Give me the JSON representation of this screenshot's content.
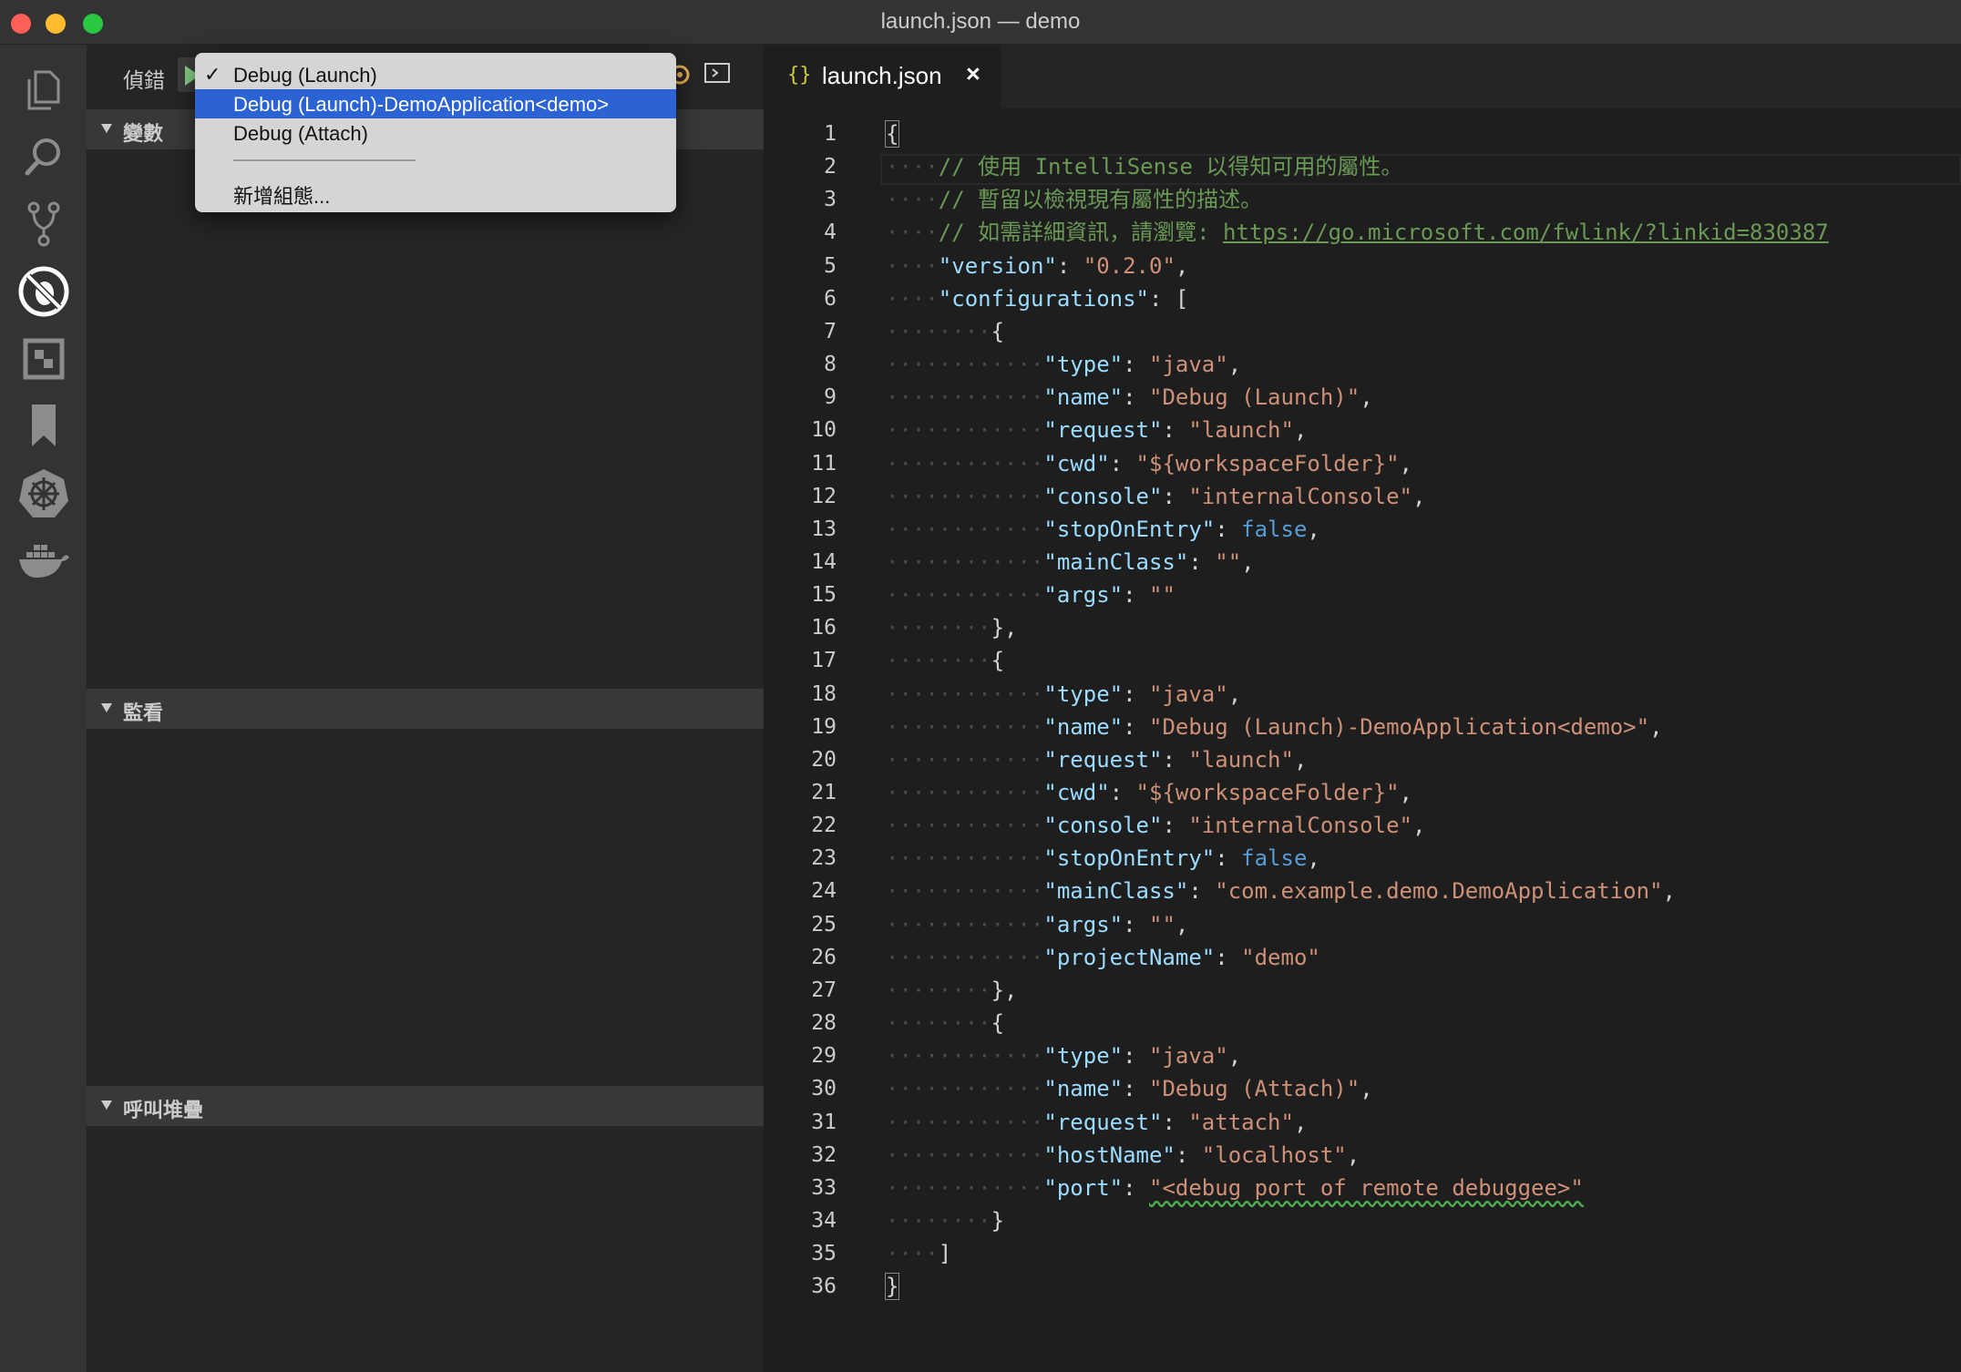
{
  "window": {
    "title": "launch.json — demo"
  },
  "activity_bar": {
    "items": [
      "explorer-icon",
      "search-icon",
      "source-control-icon",
      "debug-icon",
      "extensions-icon",
      "bookmark-icon",
      "kubernetes-icon",
      "docker-icon"
    ]
  },
  "sidebar": {
    "debug_title": "偵錯",
    "sections": {
      "variables": "變數",
      "watch": "監看",
      "call_stack": "呼叫堆疊"
    }
  },
  "dropdown": {
    "items": [
      "Debug (Launch)",
      "Debug (Launch)-DemoApplication<demo>",
      "Debug (Attach)"
    ],
    "selected_index": 1,
    "checked_index": 0,
    "check_mark": "✓",
    "add_config": "新增組態..."
  },
  "editor": {
    "tab": {
      "icon": "{}",
      "label": "launch.json",
      "close": "×"
    },
    "line_numbers": [
      "1",
      "2",
      "3",
      "4",
      "5",
      "6",
      "7",
      "8",
      "9",
      "10",
      "11",
      "12",
      "13",
      "14",
      "15",
      "16",
      "17",
      "18",
      "19",
      "20",
      "21",
      "22",
      "23",
      "24",
      "25",
      "26",
      "27",
      "28",
      "29",
      "30",
      "31",
      "32",
      "33",
      "34",
      "35",
      "36"
    ],
    "lines": [
      [
        {
          "t": "{",
          "c": "p brk"
        }
      ],
      [
        {
          "t": "····",
          "c": "ws"
        },
        {
          "t": "// 使用 IntelliSense 以得知可用的屬性。",
          "c": "c"
        }
      ],
      [
        {
          "t": "····",
          "c": "ws"
        },
        {
          "t": "// 暫留以檢視現有屬性的描述。",
          "c": "c"
        }
      ],
      [
        {
          "t": "····",
          "c": "ws"
        },
        {
          "t": "// 如需詳細資訊，請瀏覽: ",
          "c": "c"
        },
        {
          "t": "https://go.microsoft.com/fwlink/?linkid=830387",
          "c": "c lnk"
        }
      ],
      [
        {
          "t": "····",
          "c": "ws"
        },
        {
          "t": "\"version\"",
          "c": "k"
        },
        {
          "t": ": ",
          "c": "p"
        },
        {
          "t": "\"0.2.0\"",
          "c": "s"
        },
        {
          "t": ",",
          "c": "p"
        }
      ],
      [
        {
          "t": "····",
          "c": "ws"
        },
        {
          "t": "\"configurations\"",
          "c": "k"
        },
        {
          "t": ": [",
          "c": "p"
        }
      ],
      [
        {
          "t": "········",
          "c": "ws"
        },
        {
          "t": "{",
          "c": "p"
        }
      ],
      [
        {
          "t": "············",
          "c": "ws"
        },
        {
          "t": "\"type\"",
          "c": "k"
        },
        {
          "t": ": ",
          "c": "p"
        },
        {
          "t": "\"java\"",
          "c": "s"
        },
        {
          "t": ",",
          "c": "p"
        }
      ],
      [
        {
          "t": "············",
          "c": "ws"
        },
        {
          "t": "\"name\"",
          "c": "k"
        },
        {
          "t": ": ",
          "c": "p"
        },
        {
          "t": "\"Debug (Launch)\"",
          "c": "s"
        },
        {
          "t": ",",
          "c": "p"
        }
      ],
      [
        {
          "t": "············",
          "c": "ws"
        },
        {
          "t": "\"request\"",
          "c": "k"
        },
        {
          "t": ": ",
          "c": "p"
        },
        {
          "t": "\"launch\"",
          "c": "s"
        },
        {
          "t": ",",
          "c": "p"
        }
      ],
      [
        {
          "t": "············",
          "c": "ws"
        },
        {
          "t": "\"cwd\"",
          "c": "k"
        },
        {
          "t": ": ",
          "c": "p"
        },
        {
          "t": "\"${workspaceFolder}\"",
          "c": "s"
        },
        {
          "t": ",",
          "c": "p"
        }
      ],
      [
        {
          "t": "············",
          "c": "ws"
        },
        {
          "t": "\"console\"",
          "c": "k"
        },
        {
          "t": ": ",
          "c": "p"
        },
        {
          "t": "\"internalConsole\"",
          "c": "s"
        },
        {
          "t": ",",
          "c": "p"
        }
      ],
      [
        {
          "t": "············",
          "c": "ws"
        },
        {
          "t": "\"stopOnEntry\"",
          "c": "k"
        },
        {
          "t": ": ",
          "c": "p"
        },
        {
          "t": "false",
          "c": "b"
        },
        {
          "t": ",",
          "c": "p"
        }
      ],
      [
        {
          "t": "············",
          "c": "ws"
        },
        {
          "t": "\"mainClass\"",
          "c": "k"
        },
        {
          "t": ": ",
          "c": "p"
        },
        {
          "t": "\"\"",
          "c": "s"
        },
        {
          "t": ",",
          "c": "p"
        }
      ],
      [
        {
          "t": "············",
          "c": "ws"
        },
        {
          "t": "\"args\"",
          "c": "k"
        },
        {
          "t": ": ",
          "c": "p"
        },
        {
          "t": "\"\"",
          "c": "s"
        }
      ],
      [
        {
          "t": "········",
          "c": "ws"
        },
        {
          "t": "},",
          "c": "p"
        }
      ],
      [
        {
          "t": "········",
          "c": "ws"
        },
        {
          "t": "{",
          "c": "p"
        }
      ],
      [
        {
          "t": "············",
          "c": "ws"
        },
        {
          "t": "\"type\"",
          "c": "k"
        },
        {
          "t": ": ",
          "c": "p"
        },
        {
          "t": "\"java\"",
          "c": "s"
        },
        {
          "t": ",",
          "c": "p"
        }
      ],
      [
        {
          "t": "············",
          "c": "ws"
        },
        {
          "t": "\"name\"",
          "c": "k"
        },
        {
          "t": ": ",
          "c": "p"
        },
        {
          "t": "\"Debug (Launch)-DemoApplication<demo>\"",
          "c": "s"
        },
        {
          "t": ",",
          "c": "p"
        }
      ],
      [
        {
          "t": "············",
          "c": "ws"
        },
        {
          "t": "\"request\"",
          "c": "k"
        },
        {
          "t": ": ",
          "c": "p"
        },
        {
          "t": "\"launch\"",
          "c": "s"
        },
        {
          "t": ",",
          "c": "p"
        }
      ],
      [
        {
          "t": "············",
          "c": "ws"
        },
        {
          "t": "\"cwd\"",
          "c": "k"
        },
        {
          "t": ": ",
          "c": "p"
        },
        {
          "t": "\"${workspaceFolder}\"",
          "c": "s"
        },
        {
          "t": ",",
          "c": "p"
        }
      ],
      [
        {
          "t": "············",
          "c": "ws"
        },
        {
          "t": "\"console\"",
          "c": "k"
        },
        {
          "t": ": ",
          "c": "p"
        },
        {
          "t": "\"internalConsole\"",
          "c": "s"
        },
        {
          "t": ",",
          "c": "p"
        }
      ],
      [
        {
          "t": "············",
          "c": "ws"
        },
        {
          "t": "\"stopOnEntry\"",
          "c": "k"
        },
        {
          "t": ": ",
          "c": "p"
        },
        {
          "t": "false",
          "c": "b"
        },
        {
          "t": ",",
          "c": "p"
        }
      ],
      [
        {
          "t": "············",
          "c": "ws"
        },
        {
          "t": "\"mainClass\"",
          "c": "k"
        },
        {
          "t": ": ",
          "c": "p"
        },
        {
          "t": "\"com.example.demo.DemoApplication\"",
          "c": "s"
        },
        {
          "t": ",",
          "c": "p"
        }
      ],
      [
        {
          "t": "············",
          "c": "ws"
        },
        {
          "t": "\"args\"",
          "c": "k"
        },
        {
          "t": ": ",
          "c": "p"
        },
        {
          "t": "\"\"",
          "c": "s"
        },
        {
          "t": ",",
          "c": "p"
        }
      ],
      [
        {
          "t": "············",
          "c": "ws"
        },
        {
          "t": "\"projectName\"",
          "c": "k"
        },
        {
          "t": ": ",
          "c": "p"
        },
        {
          "t": "\"demo\"",
          "c": "s"
        }
      ],
      [
        {
          "t": "········",
          "c": "ws"
        },
        {
          "t": "},",
          "c": "p"
        }
      ],
      [
        {
          "t": "········",
          "c": "ws"
        },
        {
          "t": "{",
          "c": "p"
        }
      ],
      [
        {
          "t": "············",
          "c": "ws"
        },
        {
          "t": "\"type\"",
          "c": "k"
        },
        {
          "t": ": ",
          "c": "p"
        },
        {
          "t": "\"java\"",
          "c": "s"
        },
        {
          "t": ",",
          "c": "p"
        }
      ],
      [
        {
          "t": "············",
          "c": "ws"
        },
        {
          "t": "\"name\"",
          "c": "k"
        },
        {
          "t": ": ",
          "c": "p"
        },
        {
          "t": "\"Debug (Attach)\"",
          "c": "s"
        },
        {
          "t": ",",
          "c": "p"
        }
      ],
      [
        {
          "t": "············",
          "c": "ws"
        },
        {
          "t": "\"request\"",
          "c": "k"
        },
        {
          "t": ": ",
          "c": "p"
        },
        {
          "t": "\"attach\"",
          "c": "s"
        },
        {
          "t": ",",
          "c": "p"
        }
      ],
      [
        {
          "t": "············",
          "c": "ws"
        },
        {
          "t": "\"hostName\"",
          "c": "k"
        },
        {
          "t": ": ",
          "c": "p"
        },
        {
          "t": "\"localhost\"",
          "c": "s"
        },
        {
          "t": ",",
          "c": "p"
        }
      ],
      [
        {
          "t": "············",
          "c": "ws"
        },
        {
          "t": "\"port\"",
          "c": "k"
        },
        {
          "t": ": ",
          "c": "p"
        },
        {
          "t": "\"<debug port of remote debuggee>\"",
          "c": "s err"
        }
      ],
      [
        {
          "t": "········",
          "c": "ws"
        },
        {
          "t": "}",
          "c": "p"
        }
      ],
      [
        {
          "t": "····",
          "c": "ws"
        },
        {
          "t": "]",
          "c": "p"
        }
      ],
      [
        {
          "t": "}",
          "c": "p brk"
        }
      ]
    ]
  },
  "colors": {
    "accent": "#2b63d4",
    "key": "#9cdcfe",
    "string": "#ce9178",
    "comment": "#6a9955",
    "keyword": "#569cd6"
  }
}
